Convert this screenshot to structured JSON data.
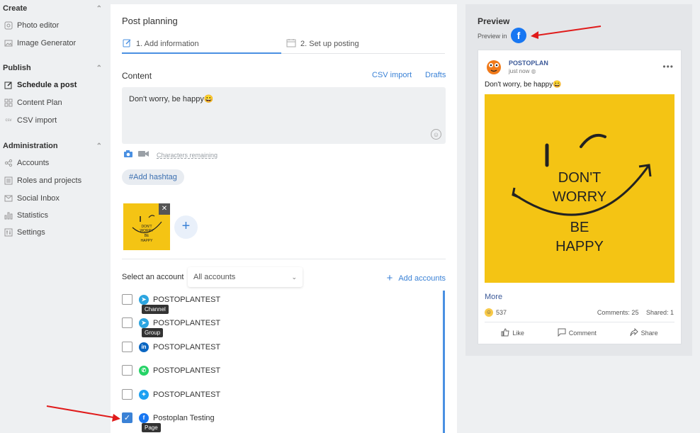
{
  "sidebar": {
    "create": {
      "heading": "Create",
      "items": [
        {
          "label": "Photo editor",
          "icon": "photo-editor-icon"
        },
        {
          "label": "Image Generator",
          "icon": "image-icon"
        }
      ]
    },
    "publish": {
      "heading": "Publish",
      "items": [
        {
          "label": "Schedule a post",
          "icon": "edit-icon"
        },
        {
          "label": "Content Plan",
          "icon": "grid-icon"
        },
        {
          "label": "CSV import",
          "icon": "csv-icon"
        }
      ]
    },
    "administration": {
      "heading": "Administration",
      "items": [
        {
          "label": "Accounts",
          "icon": "share-icon"
        },
        {
          "label": "Roles and projects",
          "icon": "list-icon"
        },
        {
          "label": "Social Inbox",
          "icon": "inbox-icon"
        },
        {
          "label": "Statistics",
          "icon": "bar-chart-icon"
        },
        {
          "label": "Settings",
          "icon": "settings-icon"
        }
      ]
    }
  },
  "planning": {
    "title": "Post planning",
    "step1": "1. Add information",
    "step2": "2. Set up posting",
    "content_label": "Content",
    "csv_import": "CSV import",
    "drafts": "Drafts",
    "post_text": "Don't worry, be happy😀",
    "chars_remaining": "Characters remaining",
    "hashtag_btn": "#Add hashtag",
    "thumb_text": [
      "DON'T",
      "WORRY",
      "BE",
      "HAPPY"
    ]
  },
  "accounts": {
    "label": "Select an account",
    "select_value": "All accounts",
    "add_accounts": "Add accounts",
    "rows": [
      {
        "name": "POSTOPLANTEST",
        "network": "telegram",
        "tooltip": "Channel",
        "checked": false
      },
      {
        "name": "POSTOPLANTEST",
        "network": "telegram",
        "tooltip": "Group",
        "checked": false
      },
      {
        "name": "POSTOPLANTEST",
        "network": "linkedin",
        "tooltip": "",
        "checked": false
      },
      {
        "name": "POSTOPLANTEST",
        "network": "whatsapp",
        "tooltip": "",
        "checked": false
      },
      {
        "name": "POSTOPLANTEST",
        "network": "twitter",
        "tooltip": "",
        "checked": false
      },
      {
        "name": "Postoplan Testing",
        "network": "facebook",
        "tooltip": "Page",
        "checked": true
      }
    ]
  },
  "preview": {
    "title": "Preview",
    "preview_in": "Preview in",
    "page_name": "POSTOPLAN",
    "time": "just now",
    "post_text": "Don't worry, be happy😀",
    "image_text": [
      "DON'T",
      "WORRY",
      "BE",
      "HAPPY"
    ],
    "more": "More",
    "reaction_count": "537",
    "comments": "Comments: 25",
    "shared": "Shared: 1",
    "like": "Like",
    "comment": "Comment",
    "share": "Share"
  },
  "colors": {
    "accent": "#3b82d6",
    "facebook": "#1877f2",
    "telegram": "#2ca5e0",
    "linkedin": "#0a66c2",
    "whatsapp": "#25d366",
    "twitter": "#1da1f2",
    "image_bg": "#f4c414",
    "annotation_arrow": "#e01b1b"
  }
}
